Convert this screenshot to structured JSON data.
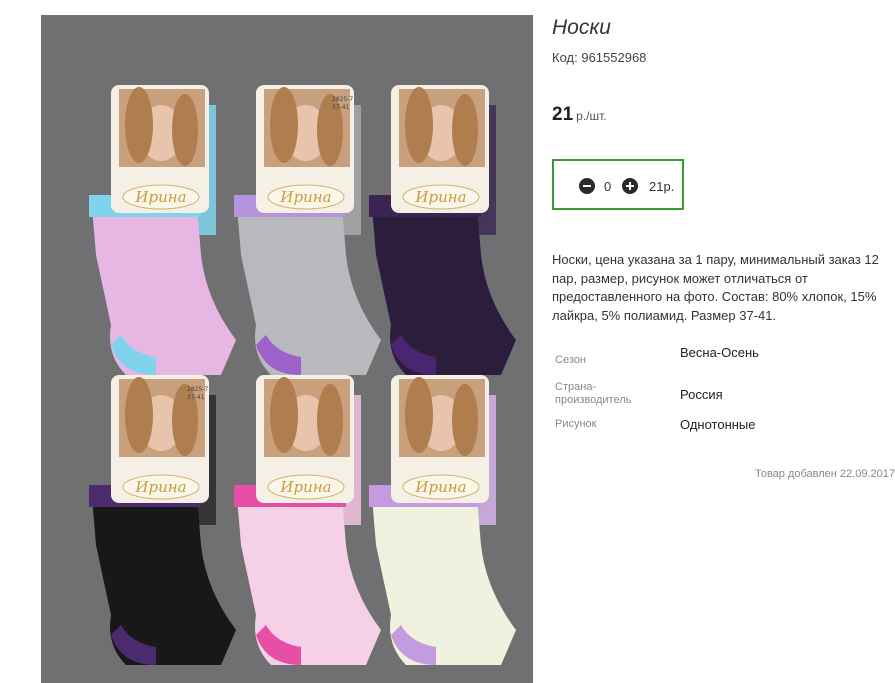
{
  "product": {
    "title": "Носки",
    "code_label": "Код:",
    "code_value": "961552968",
    "price_value": "21",
    "price_unit": "р./шт.",
    "image_brand": "Ирина",
    "image_size_tag": "37-41",
    "image_article_tag": "2825-7"
  },
  "quantity": {
    "count": "0",
    "total": "21р."
  },
  "description": "Носки, цена указана за 1 пару, минимальный заказ 12 пар, размер, рисунок может отличаться от предоставленного на фото. Состав: 80% хлопок, 15% лайкра, 5% полиамид. Размер 37-41.",
  "specs": [
    {
      "label": "Сезон",
      "value": "Весна-Осень"
    },
    {
      "label": "Страна-производитель",
      "value": "Россия"
    },
    {
      "label": "Рисунок",
      "value": "Однотонные"
    }
  ],
  "added_note": "Товар добавлен 22.09.2017",
  "colors": {
    "accent_border": "#3a9a35",
    "photo_background": "#707073"
  }
}
